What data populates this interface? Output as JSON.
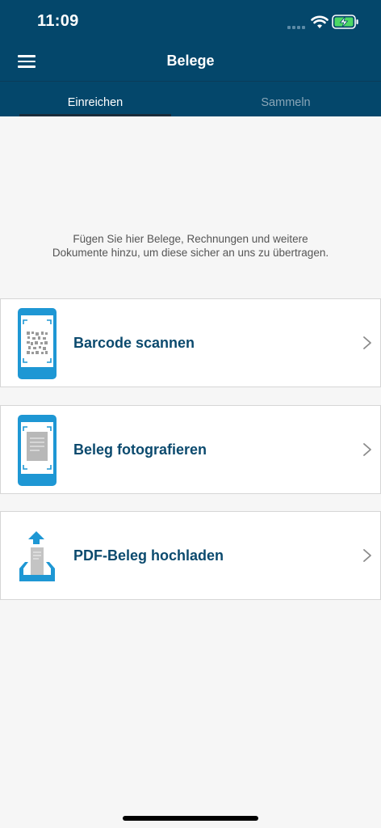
{
  "status_bar": {
    "time": "11:09"
  },
  "navbar": {
    "title": "Belege"
  },
  "tabs": [
    {
      "label": "Einreichen",
      "active": true
    },
    {
      "label": "Sammeln",
      "active": false
    }
  ],
  "intro_text": "Fügen Sie hier Belege, Rechnungen und weitere Dokumente hinzu, um diese sicher an uns zu übertragen.",
  "actions": [
    {
      "label": "Barcode scannen",
      "icon": "barcode-scan-phone-icon"
    },
    {
      "label": "Beleg fotografieren",
      "icon": "document-photo-phone-icon"
    },
    {
      "label": "PDF-Beleg hochladen",
      "icon": "pdf-upload-icon"
    }
  ],
  "colors": {
    "header": "#04476b",
    "accent": "#1e97d4",
    "label": "#0b4a6e",
    "background": "#f6f6f6"
  }
}
